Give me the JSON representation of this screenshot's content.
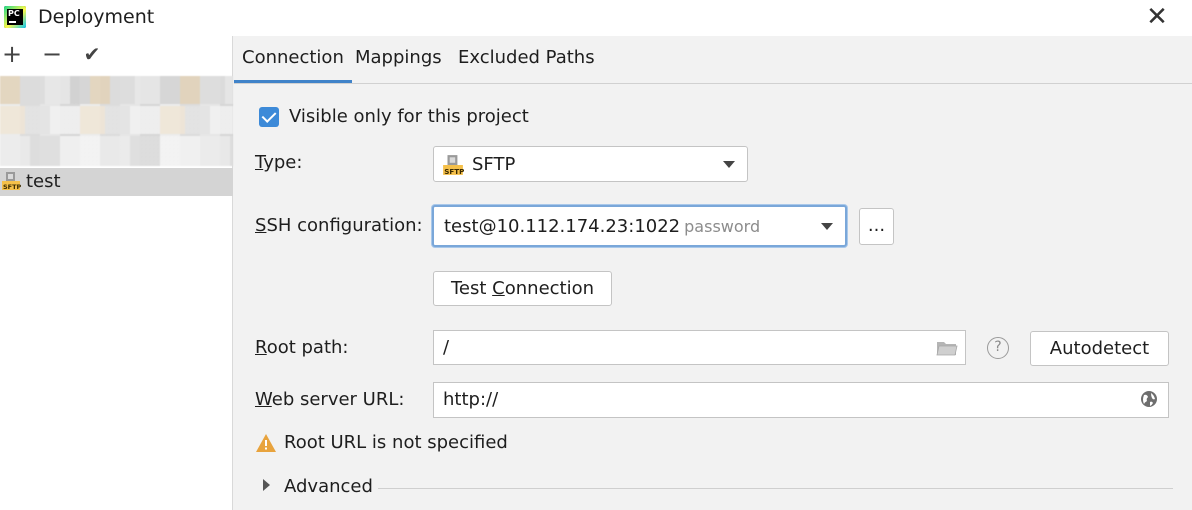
{
  "window": {
    "title": "Deployment"
  },
  "toolbar": {
    "add": "+",
    "remove": "−",
    "apply": "✔"
  },
  "servers": [
    {
      "name": "test",
      "type_badge": "SFTP"
    }
  ],
  "tabs": [
    {
      "label": "Connection"
    },
    {
      "label": "Mappings"
    },
    {
      "label": "Excluded Paths"
    }
  ],
  "connection": {
    "visible_only": {
      "label": "Visible only for this project",
      "checked": true
    },
    "type": {
      "label_first": "T",
      "label_rest": "ype:",
      "value": "SFTP",
      "badge": "SFTP"
    },
    "ssh": {
      "label_first": "S",
      "label_rest": "SH configuration:",
      "value": "test@10.112.174.23:1022",
      "hint": "password",
      "more_button": "..."
    },
    "test_connection": {
      "label_pre": "Test ",
      "label_u": "C",
      "label_post": "onnection"
    },
    "root_path": {
      "label_first": "R",
      "label_rest": "oot path:",
      "value": "/",
      "help": "?",
      "autodetect": "Autodetect"
    },
    "web_url": {
      "label_first": "W",
      "label_rest": "eb server URL:",
      "value": "http://"
    },
    "warning": "Root URL is not specified",
    "advanced": "Advanced"
  },
  "colors": {
    "accent": "#4083c9",
    "checkbox": "#3d8ad8",
    "warning": "#e8a33d"
  }
}
